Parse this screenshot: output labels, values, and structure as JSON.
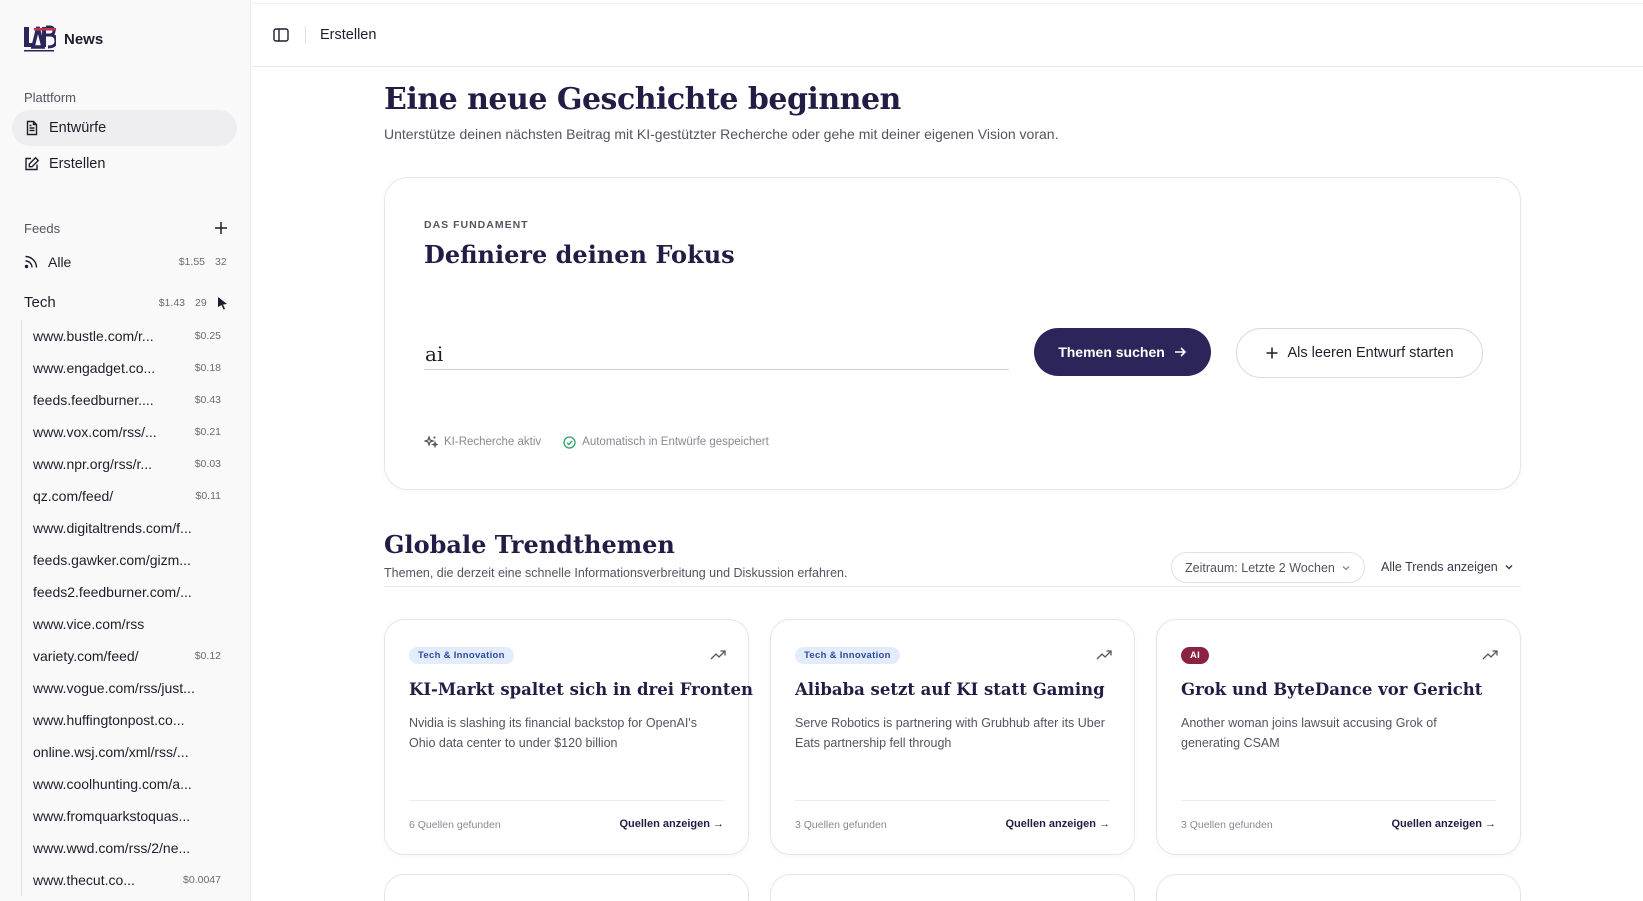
{
  "brand": {
    "name": "News",
    "logo_text": "LABS"
  },
  "sidebar": {
    "platform_label": "Plattform",
    "nav": [
      {
        "label": "Entwürfe",
        "icon": "document-icon",
        "active": true
      },
      {
        "label": "Erstellen",
        "icon": "edit-icon",
        "active": false
      }
    ],
    "feeds_label": "Feeds",
    "all_feeds": {
      "label": "Alle",
      "cost": "$1.55",
      "count": "32"
    },
    "tech_group": {
      "label": "Tech",
      "cost": "$1.43",
      "count": "29"
    },
    "tech_feeds": [
      {
        "name": "www.bustle.com/r...",
        "cost": "$0.25"
      },
      {
        "name": "www.engadget.co...",
        "cost": "$0.18"
      },
      {
        "name": "feeds.feedburner....",
        "cost": "$0.43"
      },
      {
        "name": "www.vox.com/rss/...",
        "cost": "$0.21"
      },
      {
        "name": "www.npr.org/rss/r...",
        "cost": "$0.03"
      },
      {
        "name": "qz.com/feed/",
        "cost": "$0.11"
      },
      {
        "name": "www.digitaltrends.com/f...",
        "cost": ""
      },
      {
        "name": "feeds.gawker.com/gizm...",
        "cost": ""
      },
      {
        "name": "feeds2.feedburner.com/...",
        "cost": ""
      },
      {
        "name": "www.vice.com/rss",
        "cost": ""
      },
      {
        "name": "variety.com/feed/",
        "cost": "$0.12"
      },
      {
        "name": "www.vogue.com/rss/just...",
        "cost": ""
      },
      {
        "name": "www.huffingtonpost.co...",
        "cost": ""
      },
      {
        "name": "online.wsj.com/xml/rss/...",
        "cost": ""
      },
      {
        "name": "www.coolhunting.com/a...",
        "cost": ""
      },
      {
        "name": "www.fromquarkstoquas...",
        "cost": ""
      },
      {
        "name": "www.wwd.com/rss/2/ne...",
        "cost": ""
      },
      {
        "name": "www.thecut.co...",
        "cost": "$0.0047"
      }
    ]
  },
  "topbar": {
    "breadcrumb": "Erstellen"
  },
  "main": {
    "title": "Eine neue Geschichte beginnen",
    "subtitle": "Unterstütze deinen nächsten Beitrag mit KI-gestützter Recherche oder gehe mit deiner eigenen Vision voran.",
    "focus": {
      "eyebrow": "DAS FUNDAMENT",
      "title": "Definiere deinen Fokus",
      "input_value": "ai",
      "search_button": "Themen suchen",
      "empty_draft_button": "Als leeren Entwurf starten",
      "status_ai": "KI-Recherche aktiv",
      "status_saved": "Automatisch in Entwürfe gespeichert"
    },
    "trends": {
      "title": "Globale Trendthemen",
      "subtitle": "Themen, die derzeit eine schnelle Informationsverbreitung und Diskussion erfahren.",
      "range": "Zeitraum: Letzte 2 Wochen",
      "all_trends": "Alle Trends anzeigen",
      "cards": [
        {
          "badge": "Tech & Innovation",
          "badge_type": "tech",
          "title": "KI-Markt spaltet sich in drei Fronten",
          "desc": "Nvidia is slashing its financial backstop for OpenAI's Ohio data center to under $120 billion",
          "sources": "6 Quellen gefunden",
          "link": "Quellen anzeigen →"
        },
        {
          "badge": "Tech & Innovation",
          "badge_type": "tech",
          "title": "Alibaba setzt auf KI statt Gaming",
          "desc": "Serve Robotics is partnering with Grubhub after its Uber Eats partnership fell through",
          "sources": "3 Quellen gefunden",
          "link": "Quellen anzeigen →"
        },
        {
          "badge": "AI",
          "badge_type": "ai",
          "title": "Grok und ByteDance vor Gericht",
          "desc": "Another woman joins lawsuit accusing Grok of generating CSAM",
          "sources": "3 Quellen gefunden",
          "link": "Quellen anzeigen →"
        }
      ]
    }
  },
  "colors": {
    "primary": "#2b255a",
    "heading": "#221d44",
    "badge_tech_bg": "#e3ecfb",
    "badge_ai_bg": "#8a2342",
    "check_green": "#2fa36b"
  }
}
